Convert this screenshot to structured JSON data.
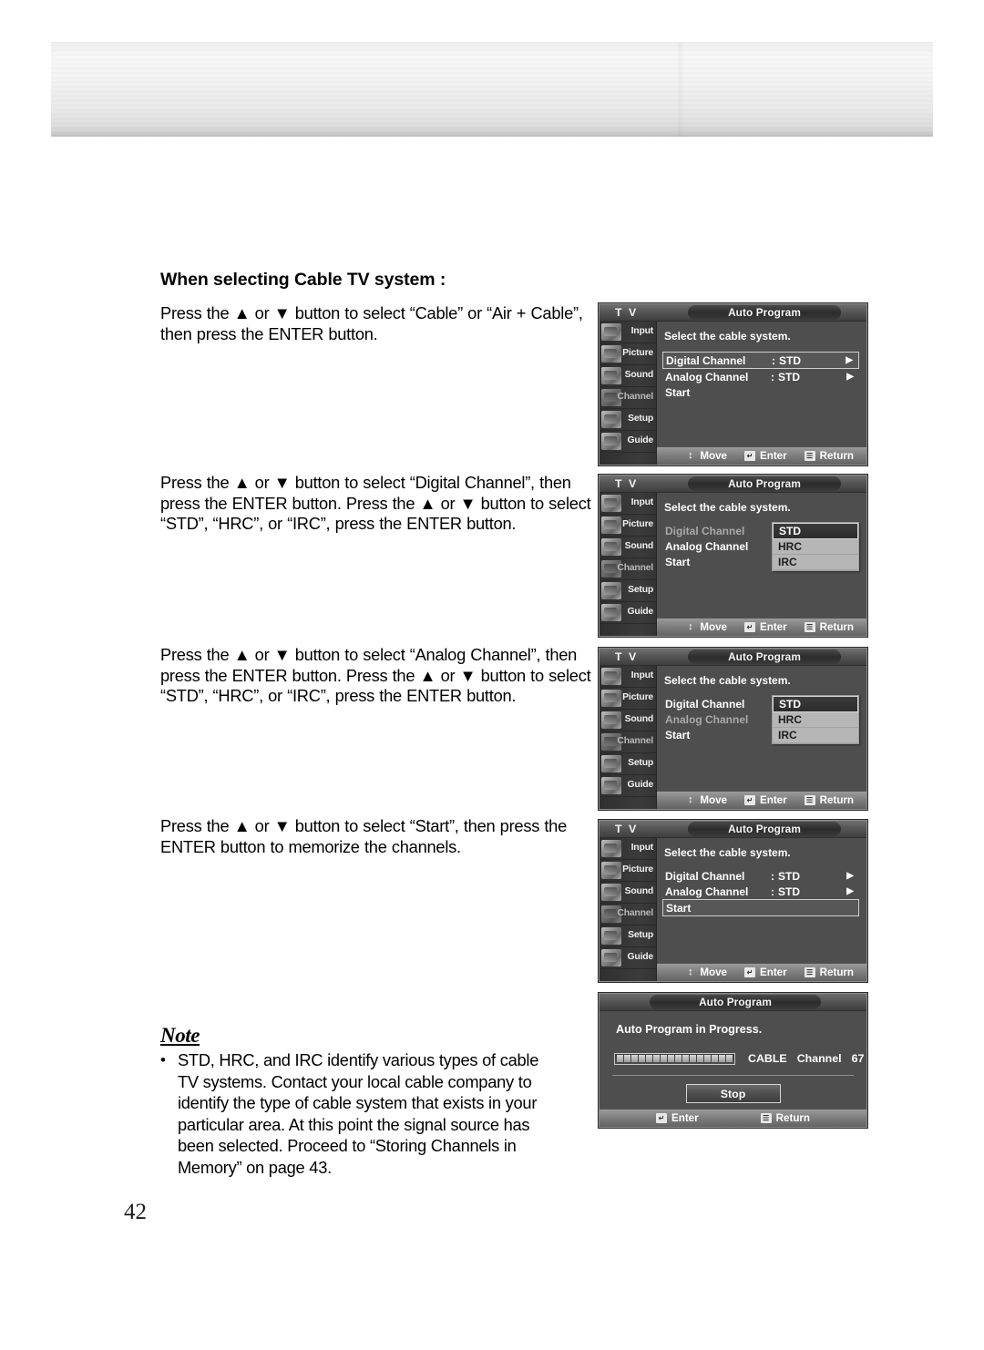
{
  "document": {
    "section_title": "When selecting Cable TV system :",
    "page_number": "42"
  },
  "instructions": [
    {
      "id": "step1",
      "text": "Press the ▲ or ▼ button to select “Cable” or “Air + Cable”, then press the ENTER button."
    },
    {
      "id": "step2",
      "text": "Press the ▲ or ▼ button to select “Digital Channel”, then press the ENTER button. Press the ▲ or ▼ button to select “STD”, “HRC”, or “IRC”, press the ENTER button."
    },
    {
      "id": "step3",
      "text": "Press the ▲ or ▼ button to select “Analog Channel”, then press the ENTER button. Press the ▲ or ▼ button to select “STD”, “HRC”, or “IRC”, press the ENTER button."
    },
    {
      "id": "step4",
      "text": "Press the ▲ or ▼ button to select “Start”, then press the ENTER button to memorize the channels."
    }
  ],
  "note": {
    "heading": "Note",
    "bullet_glyph": "•",
    "body": "STD, HRC, and IRC identify various types of cable TV systems. Contact your local cable company to identify the type of cable system that exists in your particular area. At this point the signal source has been selected. Proceed to “Storing Channels in Memory” on page 43."
  },
  "osd_common": {
    "tv_label": "T V",
    "title": "Auto Program",
    "hint": "Select the cable system.",
    "sidebar": [
      {
        "label": "Input",
        "icon": "input-icon"
      },
      {
        "label": "Picture",
        "icon": "picture-icon"
      },
      {
        "label": "Sound",
        "icon": "sound-icon"
      },
      {
        "label": "Channel",
        "icon": "channel-icon"
      },
      {
        "label": "Setup",
        "icon": "setup-icon"
      },
      {
        "label": "Guide",
        "icon": "guide-icon"
      }
    ],
    "footer": {
      "move": "Move",
      "enter": "Enter",
      "return": "Return",
      "move_icon": "↕",
      "enter_icon": "↵",
      "return_icon": "☰"
    },
    "rows": {
      "digital": "Digital Channel",
      "analog": "Analog Channel",
      "start": "Start",
      "colon": ":",
      "value_std": "STD",
      "arrow": "▶"
    },
    "dropdown_options": [
      "STD",
      "HRC",
      "IRC"
    ]
  },
  "panels": [
    {
      "id": "panel-1",
      "selected_row": "digital",
      "digital_value": "STD",
      "analog_value": "STD",
      "dimmed_row": null,
      "dropdown_open": false
    },
    {
      "id": "panel-2",
      "selected_row": null,
      "digital_value": "STD",
      "analog_value": "STD",
      "dimmed_row": "digital",
      "dropdown_open": true
    },
    {
      "id": "panel-3",
      "selected_row": null,
      "digital_value": "STD",
      "analog_value": "STD",
      "dimmed_row": "analog",
      "dropdown_open": true
    },
    {
      "id": "panel-4",
      "selected_row": "start",
      "digital_value": "STD",
      "analog_value": "STD",
      "dimmed_row": null,
      "dropdown_open": false
    }
  ],
  "progress_panel": {
    "title": "Auto Program",
    "message": "Auto Program in Progress.",
    "source": "CABLE",
    "channel_label": "Channel",
    "channel_number": "67",
    "segments": 16,
    "stop_label": "Stop",
    "footer": {
      "enter": "Enter",
      "return": "Return",
      "enter_icon": "↵",
      "return_icon": "☰"
    }
  },
  "colors": {
    "osd_bg": "#4e4e4e",
    "osd_sidebar": "#343434",
    "osd_footer": "#7d7d7d",
    "osd_text": "#ffffff",
    "osd_dim_text": "#a9a9a9",
    "dropdown_bg": "#b6b6b6",
    "dropdown_active": "#2c2c2c",
    "page_text": "#000000"
  }
}
